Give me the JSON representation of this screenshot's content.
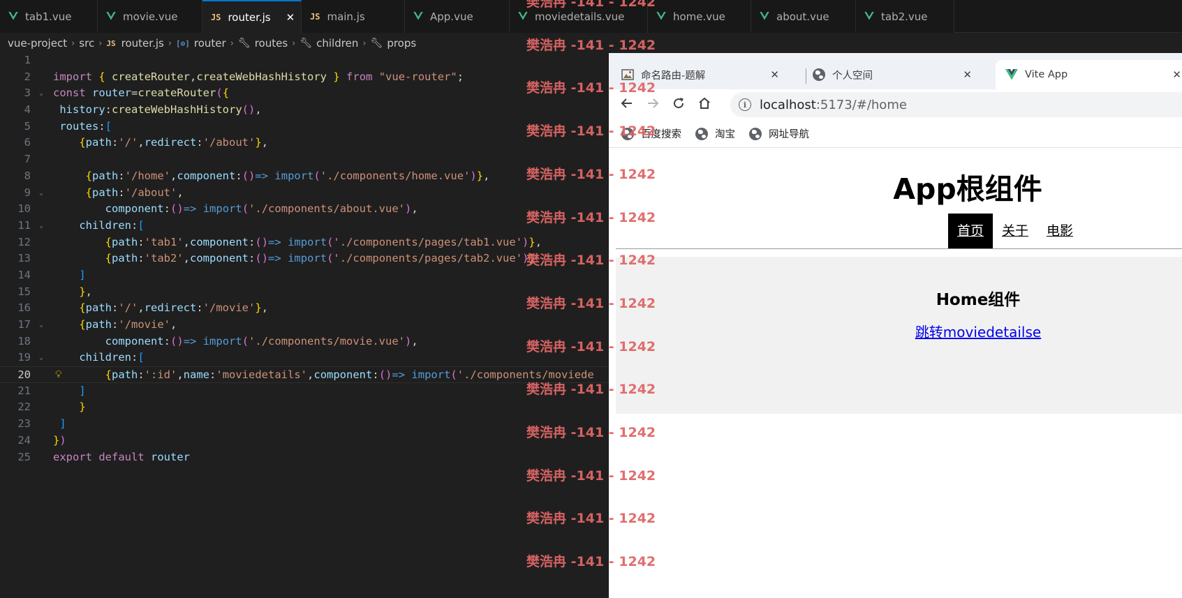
{
  "editor": {
    "tabs": [
      {
        "label": "tab1.vue",
        "icon": "vue-icon",
        "active": false
      },
      {
        "label": "movie.vue",
        "icon": "vue-icon",
        "active": false
      },
      {
        "label": "router.js",
        "icon": "js-icon",
        "active": true
      },
      {
        "label": "main.js",
        "icon": "js-icon",
        "active": false
      },
      {
        "label": "App.vue",
        "icon": "vue-icon",
        "active": false
      },
      {
        "label": "moviedetails.vue",
        "icon": "vue-icon",
        "active": false
      },
      {
        "label": "home.vue",
        "icon": "vue-icon",
        "active": false
      },
      {
        "label": "about.vue",
        "icon": "vue-icon",
        "active": false
      },
      {
        "label": "tab2.vue",
        "icon": "vue-icon",
        "active": false
      }
    ],
    "breadcrumb": [
      "vue-project",
      "src",
      "router.js",
      "router",
      "routes",
      "children",
      "props"
    ],
    "current_line": 20,
    "lines": [
      "",
      "import { createRouter,createWebHashHistory } from \"vue-router\";",
      "const router=createRouter({",
      " history:createWebHashHistory(),",
      " routes:[",
      "    {path:'/',redirect:'/about'},",
      "",
      "     {path:'/home',component:()=> import('./components/home.vue')},",
      "     {path:'/about',",
      "        component:()=> import('./components/about.vue'),",
      "    children:[",
      "        {path:'tab1',component:()=> import('./components/pages/tab1.vue')},",
      "        {path:'tab2',component:()=> import('./components/pages/tab2.vue')}",
      "    ]",
      "    },",
      "    {path:'/',redirect:'/movie'},",
      "    {path:'/movie',",
      "        component:()=> import('./components/movie.vue'),",
      "    children:[",
      "        {path:':id',name:'moviedetails',component:()=> import('./components/moviede",
      "    ]",
      "    }",
      " ]",
      "})",
      "export default router"
    ]
  },
  "watermark": {
    "text": "樊浩冉 -141 - 1242"
  },
  "browser": {
    "tabs": [
      {
        "title": "命名路由-题解",
        "icon": "image-icon"
      },
      {
        "title": "个人空间",
        "icon": "globe-icon"
      },
      {
        "title": "Vite App",
        "icon": "vue-icon"
      }
    ],
    "url_host": "localhost",
    "url_path": ":5173/#/home",
    "bookmarks": [
      "百度搜索",
      "淘宝",
      "网址导航"
    ],
    "page": {
      "title": "App根组件",
      "nav": [
        "首页",
        "关于",
        "电影"
      ],
      "active_nav": 0,
      "home_heading": "Home组件",
      "home_link": "跳转moviedetailse"
    }
  },
  "colors": {
    "accent": "#0078d4",
    "vue_green": "#42b883",
    "watermark": "#e06666"
  }
}
